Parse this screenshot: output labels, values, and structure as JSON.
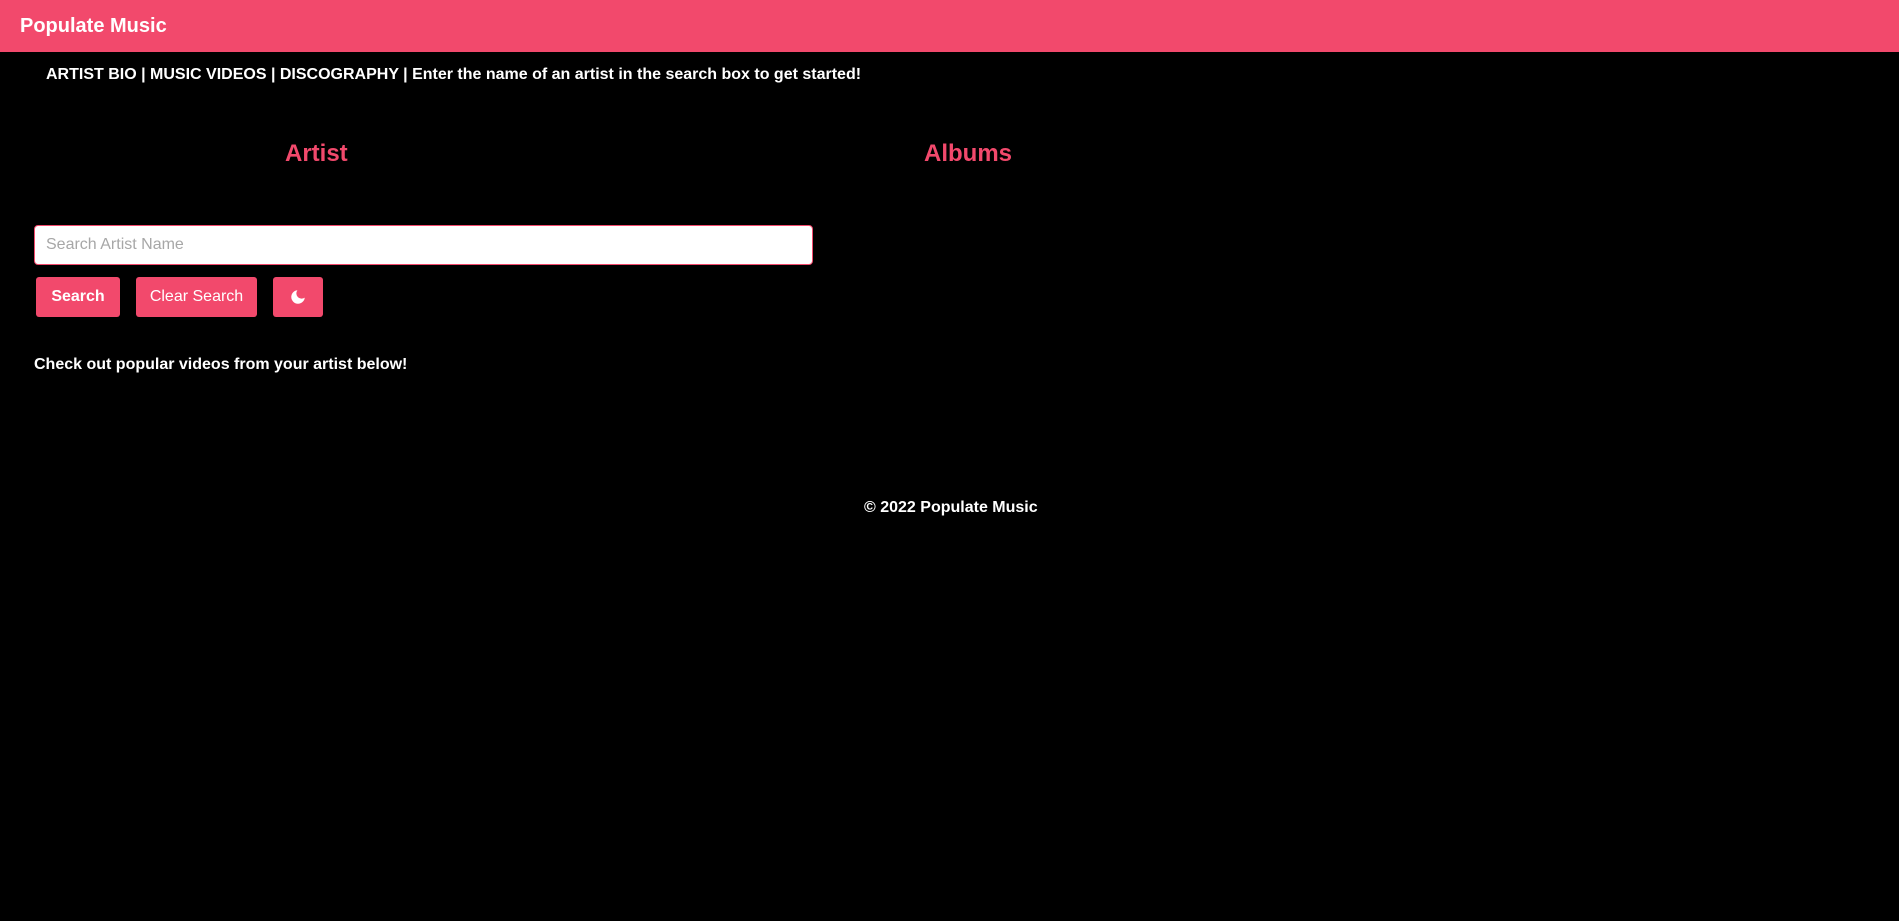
{
  "header": {
    "brand": "Populate Music"
  },
  "tagline": "ARTIST BIO | MUSIC VIDEOS | DISCOGRAPHY | Enter the name of an artist in the search box to get started!",
  "columns": {
    "artist_heading": "Artist",
    "albums_heading": "Albums"
  },
  "search": {
    "placeholder": "Search Artist Name",
    "value": "",
    "search_label": "Search",
    "clear_label": "Clear Search",
    "theme_icon": "moon-icon"
  },
  "videos_text": "Check out popular videos from your artist below!",
  "footer": {
    "text": "© 2022 Populate Music"
  },
  "colors": {
    "accent": "#f2496c",
    "background": "#000000",
    "text": "#ffffff"
  }
}
